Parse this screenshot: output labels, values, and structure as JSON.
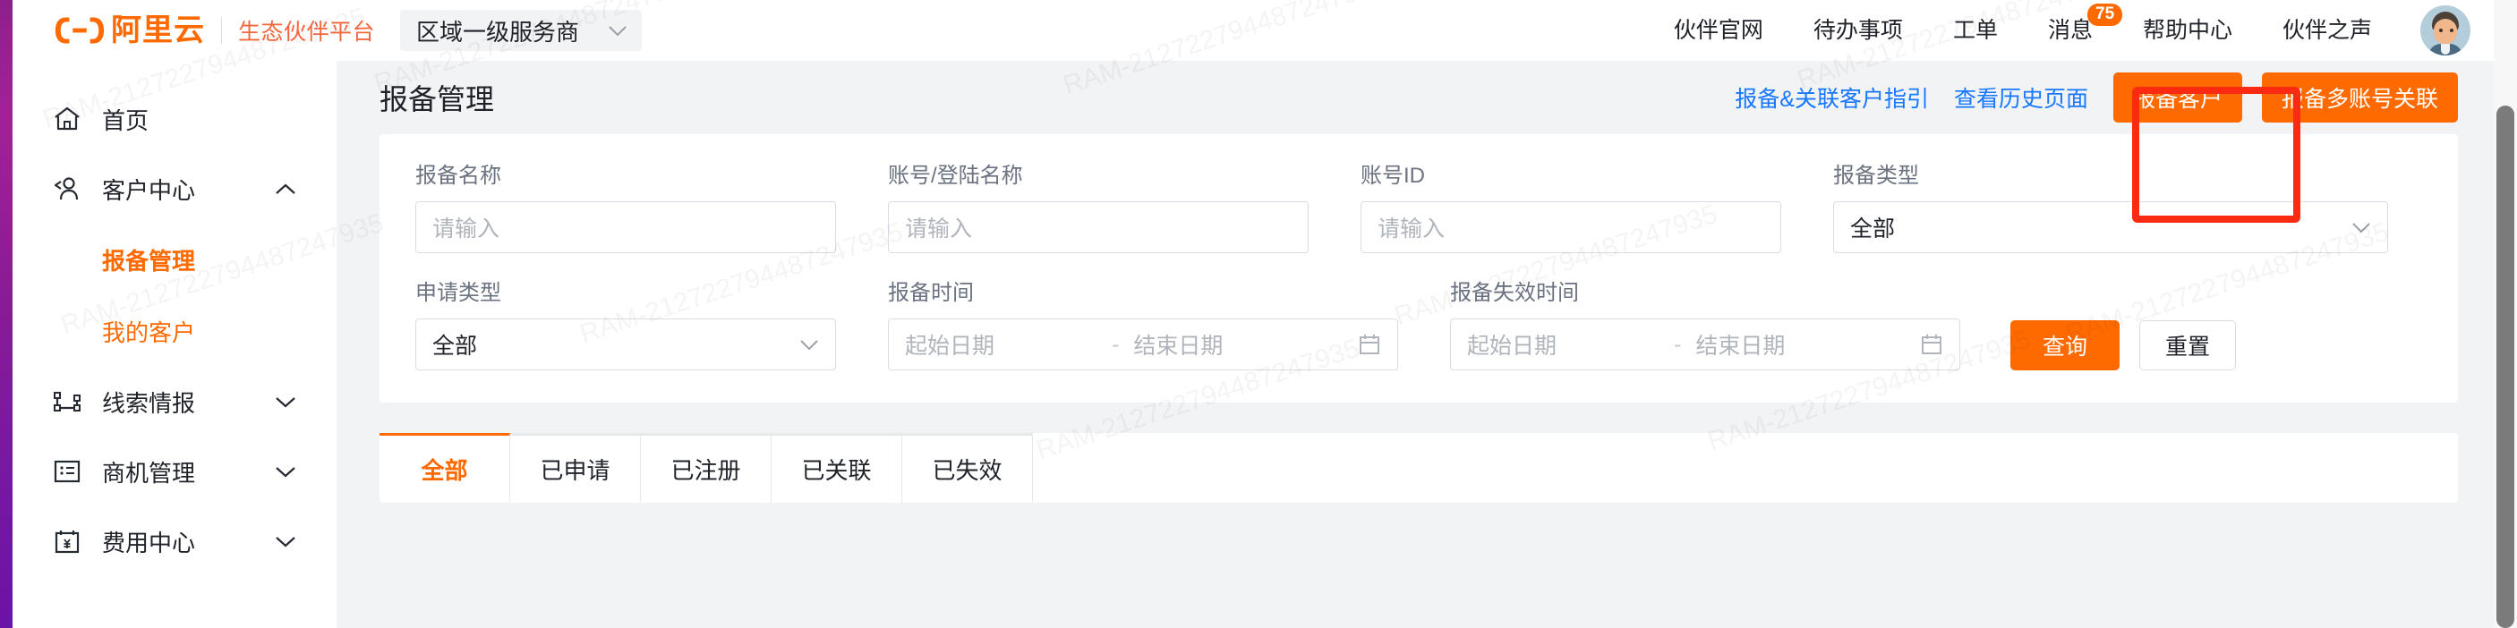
{
  "brand": {
    "logo_text": "阿里云",
    "logo_icon": "alibaba-cloud-logo-icon",
    "subtitle": "生态伙伴平台"
  },
  "region_selector": {
    "value": "区域一级服务商",
    "caret_icon": "chevron-down-icon"
  },
  "topnav": {
    "items": [
      {
        "label": "伙伴官网"
      },
      {
        "label": "待办事项"
      },
      {
        "label": "工单"
      },
      {
        "label": "消息",
        "badge": "75"
      },
      {
        "label": "帮助中心"
      },
      {
        "label": "伙伴之声"
      }
    ],
    "avatar_name": "user-avatar"
  },
  "sidebar": {
    "items": [
      {
        "label": "首页",
        "icon": "home-icon",
        "caret": "",
        "expanded": false
      },
      {
        "label": "客户中心",
        "icon": "users-icon",
        "caret": "chevron-up-icon",
        "expanded": true
      },
      {
        "label": "线索情报",
        "icon": "leads-icon",
        "caret": "chevron-down-icon",
        "expanded": false
      },
      {
        "label": "商机管理",
        "icon": "list-box-icon",
        "caret": "chevron-down-icon",
        "expanded": false
      },
      {
        "label": "费用中心",
        "icon": "yen-calendar-icon",
        "caret": "chevron-down-icon",
        "expanded": false
      }
    ],
    "sub_items": [
      {
        "label": "报备管理",
        "active": true
      },
      {
        "label": "我的客户",
        "active": false
      }
    ]
  },
  "page": {
    "title": "报备管理",
    "links": [
      {
        "label": "报备&关联客户指引"
      },
      {
        "label": "查看历史页面"
      }
    ],
    "buttons": [
      {
        "label": "报备客户",
        "style": "primary",
        "highlighted": true
      },
      {
        "label": "报备多账号关联",
        "style": "primary",
        "highlighted": false
      }
    ]
  },
  "filters": {
    "row1": [
      {
        "label": "报备名称",
        "type": "input",
        "value": "",
        "placeholder": "请输入"
      },
      {
        "label": "账号/登陆名称",
        "type": "input",
        "value": "",
        "placeholder": "请输入"
      },
      {
        "label": "账号ID",
        "type": "input",
        "value": "",
        "placeholder": "请输入"
      },
      {
        "label": "报备类型",
        "type": "select",
        "value": "全部",
        "caret_icon": "chevron-down-icon"
      }
    ],
    "row2": [
      {
        "label": "申请类型",
        "type": "select",
        "value": "全部",
        "caret_icon": "chevron-down-icon"
      },
      {
        "label": "报备时间",
        "type": "daterange",
        "start_placeholder": "起始日期",
        "separator": "-",
        "end_placeholder": "结束日期",
        "calendar_icon": "calendar-icon"
      },
      {
        "label": "报备失效时间",
        "type": "daterange",
        "start_placeholder": "起始日期",
        "separator": "-",
        "end_placeholder": "结束日期",
        "calendar_icon": "calendar-icon"
      }
    ],
    "actions": {
      "submit_label": "查询",
      "reset_label": "重置"
    }
  },
  "tabs": [
    {
      "label": "全部",
      "active": true
    },
    {
      "label": "已申请",
      "active": false
    },
    {
      "label": "已注册",
      "active": false
    },
    {
      "label": "已关联",
      "active": false
    },
    {
      "label": "已失效",
      "active": false
    }
  ],
  "watermark": {
    "text": "RAM-21272279448724793 5",
    "short": "RAM-212722794487247935"
  },
  "colors": {
    "brand_orange": "#ff6a00",
    "link_blue": "#1677ff",
    "highlight_red": "#fb2b12",
    "page_bg": "#f2f3f5"
  }
}
